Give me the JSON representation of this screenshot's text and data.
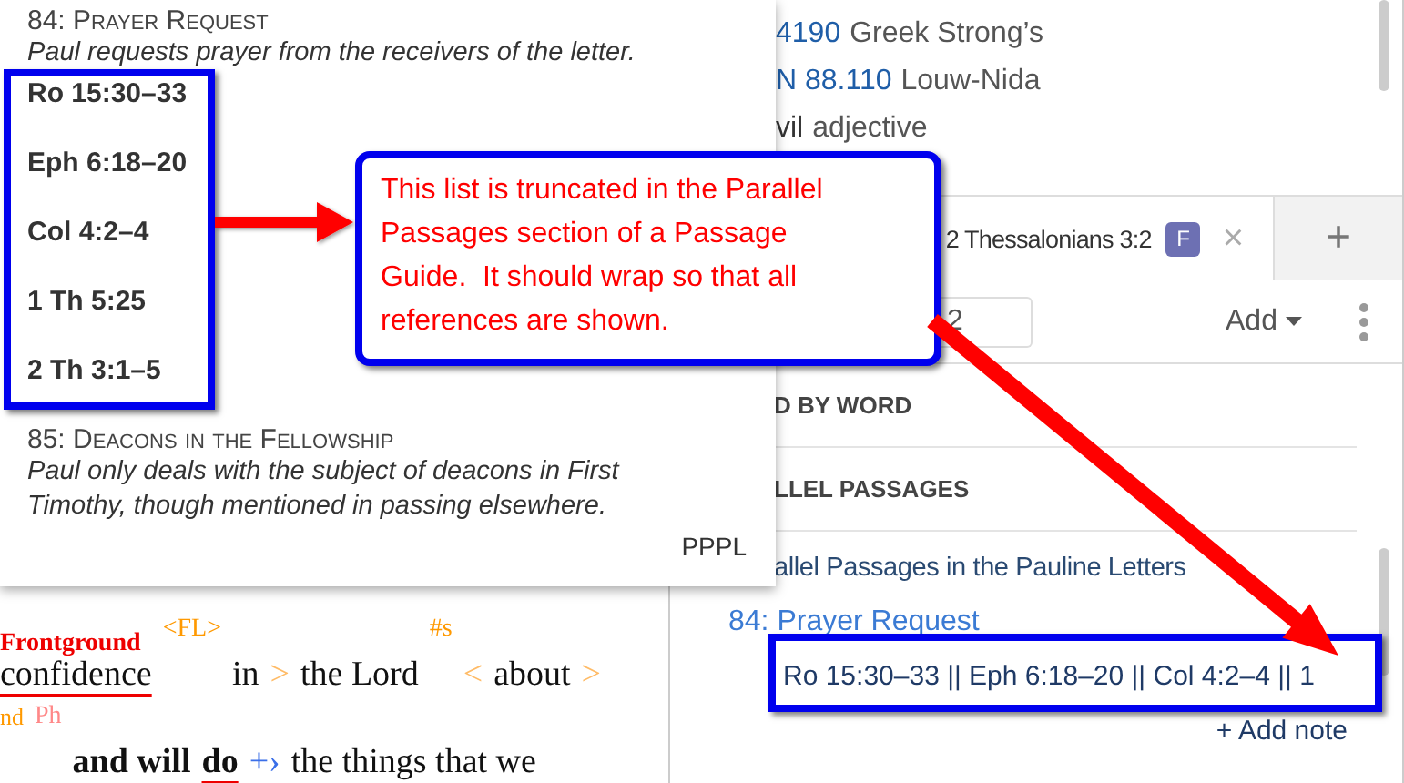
{
  "popup": {
    "entries": [
      {
        "heading": "84: Prayer Request",
        "description": "Paul requests prayer from the receivers of the letter.",
        "references": [
          "Ro 15:30–33",
          "Eph 6:18–20",
          "Col 4:2–4",
          "1 Th 5:25",
          "2 Th 3:1–5"
        ]
      },
      {
        "heading": "85: Deacons in the Fellowship",
        "description": "Paul only deals with the subject of deacons in First Timothy, though mentioned in passing elsewhere."
      }
    ],
    "source": "PPPL"
  },
  "bible_text": {
    "lines": [
      {
        "tokens": [
          {
            "kind": "word",
            "text": "confidence",
            "underline": true,
            "label": "Frontground"
          },
          {
            "kind": "tag",
            "text": "<FL>"
          },
          {
            "kind": "word",
            "text": "in"
          },
          {
            "kind": "bracket",
            "text": ">"
          },
          {
            "kind": "word",
            "text": "the Lord"
          },
          {
            "kind": "tag",
            "text": "#s"
          },
          {
            "kind": "bracket",
            "text": "<"
          },
          {
            "kind": "word",
            "text": "about"
          },
          {
            "kind": "bracket",
            "text": ">"
          }
        ]
      },
      {
        "label": "nd",
        "tokens": [
          {
            "kind": "note",
            "text": "Ph"
          },
          {
            "kind": "word",
            "text": "and will",
            "bold": true
          },
          {
            "kind": "word",
            "text": "do",
            "bold": true,
            "underline": true
          },
          {
            "kind": "link",
            "text": "+›"
          },
          {
            "kind": "word",
            "text": "the things that we"
          }
        ]
      }
    ]
  },
  "lexicon": [
    {
      "kind": "ref",
      "code": "4190",
      "label": "Greek Strong’s"
    },
    {
      "kind": "ref",
      "code": "N 88.110",
      "label": "Louw-Nida"
    },
    {
      "kind": "word",
      "code": "vil",
      "label": "adjective"
    }
  ],
  "tab": {
    "title": "2 Thessalonians 3:2",
    "badge": "F",
    "close": "×"
  },
  "new_tab": "+",
  "toolbar": {
    "reference": "2",
    "add": "Add"
  },
  "sections": [
    {
      "heading": "D BY WORD"
    },
    {
      "heading": "LLEL PASSAGES"
    }
  ],
  "parallel": {
    "collection": "allel Passages in the Pauline Letters",
    "entry": "84: Prayer Request",
    "references": "Ro 15:30–33 || Eph 6:18–20 || Col 4:2–4 || 1",
    "add_note": "+ Add note"
  },
  "annotation": {
    "callout": "This list is truncated in the Parallel Passages section of a Passage Guide.  It should wrap so that all references are shown."
  }
}
